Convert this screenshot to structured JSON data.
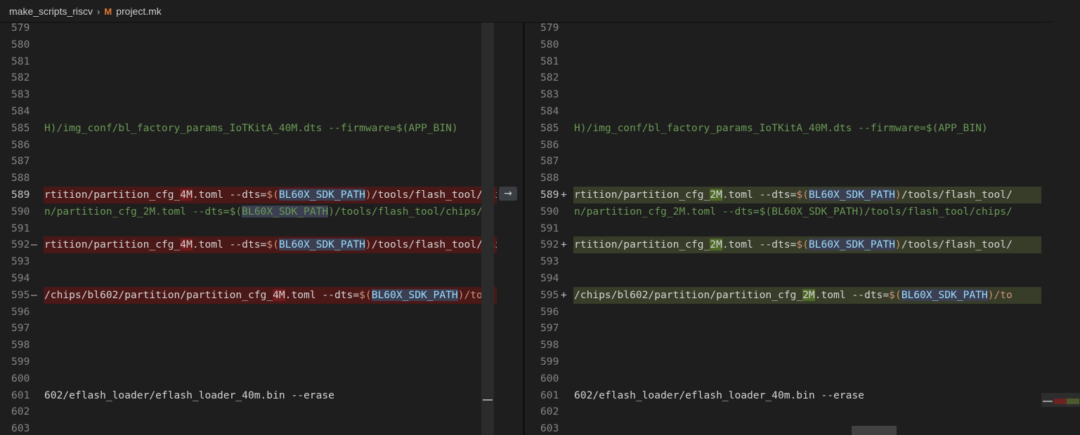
{
  "breadcrumb": {
    "folder": "make_scripts_riscv",
    "separator": "›",
    "file_icon": "M",
    "file": "project.mk"
  },
  "colors": {
    "deleted_line": "#4b1818",
    "inserted_line": "#373d29",
    "deleted_highlight": "#6f1b1b",
    "inserted_highlight": "#4f6a28"
  },
  "revert_button": "→",
  "left": {
    "lines": [
      {
        "num": "579",
        "sign": "",
        "type": "",
        "segments": []
      },
      {
        "num": "580",
        "sign": "",
        "type": "",
        "segments": []
      },
      {
        "num": "581",
        "sign": "",
        "type": "",
        "segments": []
      },
      {
        "num": "582",
        "sign": "",
        "type": "",
        "segments": []
      },
      {
        "num": "583",
        "sign": "",
        "type": "",
        "segments": []
      },
      {
        "num": "584",
        "sign": "",
        "type": "",
        "segments": []
      },
      {
        "num": "585",
        "sign": "",
        "type": "",
        "segments": [
          {
            "text": "H)/img_conf/bl_factory_params_IoTKitA_40M.dts --firmware=$(APP_BIN)",
            "cls": "t-green"
          }
        ]
      },
      {
        "num": "586",
        "sign": "",
        "type": "",
        "segments": []
      },
      {
        "num": "587",
        "sign": "",
        "type": "",
        "segments": []
      },
      {
        "num": "588",
        "sign": "",
        "type": "",
        "segments": []
      },
      {
        "num": "589",
        "sign": "",
        "type": "del",
        "active": true,
        "segments": [
          {
            "text": "rtition/partition_cfg_",
            "cls": "t-white"
          },
          {
            "text": "4M",
            "cls": "t-white hl-del"
          },
          {
            "text": ".toml --dts=",
            "cls": "t-white"
          },
          {
            "text": "$(",
            "cls": "t-orange"
          },
          {
            "text": "BL60X_SDK_PATH",
            "cls": "t-blue hl-var"
          },
          {
            "text": ")",
            "cls": "t-orange"
          },
          {
            "text": "/tools/flash_tool/chips/",
            "cls": "t-white"
          }
        ]
      },
      {
        "num": "590",
        "sign": "",
        "type": "",
        "segments": [
          {
            "text": "n/partition_cfg_2M.toml --dts=$(",
            "cls": "t-dim"
          },
          {
            "text": "BL60X_SDK_PATH",
            "cls": "t-dim hl-var"
          },
          {
            "text": ")/tools/flash_tool/chips/",
            "cls": "t-dim"
          }
        ]
      },
      {
        "num": "591",
        "sign": "",
        "type": "",
        "segments": []
      },
      {
        "num": "592",
        "sign": "—",
        "type": "del",
        "segments": [
          {
            "text": "rtition/partition_cfg_",
            "cls": "t-white"
          },
          {
            "text": "4M",
            "cls": "t-white hl-del"
          },
          {
            "text": ".toml --dts=",
            "cls": "t-white"
          },
          {
            "text": "$(",
            "cls": "t-orange"
          },
          {
            "text": "BL60X_SDK_PATH",
            "cls": "t-blue hl-var"
          },
          {
            "text": ")",
            "cls": "t-orange"
          },
          {
            "text": "/tools/flash_tool/chips/",
            "cls": "t-white"
          }
        ]
      },
      {
        "num": "593",
        "sign": "",
        "type": "",
        "segments": []
      },
      {
        "num": "594",
        "sign": "",
        "type": "",
        "segments": []
      },
      {
        "num": "595",
        "sign": "—",
        "type": "del",
        "segments": [
          {
            "text": "/chips/bl602/partition/partition_cfg_",
            "cls": "t-white"
          },
          {
            "text": "4M",
            "cls": "t-white hl-del"
          },
          {
            "text": ".toml --dts=",
            "cls": "t-white"
          },
          {
            "text": "$(",
            "cls": "t-orange"
          },
          {
            "text": "BL60X_SDK_PATH",
            "cls": "t-blue hl-var"
          },
          {
            "text": ")/to",
            "cls": "t-orange"
          }
        ]
      },
      {
        "num": "596",
        "sign": "",
        "type": "",
        "segments": []
      },
      {
        "num": "597",
        "sign": "",
        "type": "",
        "segments": []
      },
      {
        "num": "598",
        "sign": "",
        "type": "",
        "segments": []
      },
      {
        "num": "599",
        "sign": "",
        "type": "",
        "segments": []
      },
      {
        "num": "600",
        "sign": "",
        "type": "",
        "segments": []
      },
      {
        "num": "601",
        "sign": "",
        "type": "",
        "segments": [
          {
            "text": "602/eflash_loader/eflash_loader_40m.bin --erase",
            "cls": "t-white"
          }
        ]
      },
      {
        "num": "602",
        "sign": "",
        "type": "",
        "segments": []
      },
      {
        "num": "603",
        "sign": "",
        "type": "",
        "segments": []
      }
    ]
  },
  "right": {
    "lines": [
      {
        "num": "579",
        "sign": "",
        "type": "",
        "segments": []
      },
      {
        "num": "580",
        "sign": "",
        "type": "",
        "segments": []
      },
      {
        "num": "581",
        "sign": "",
        "type": "",
        "segments": []
      },
      {
        "num": "582",
        "sign": "",
        "type": "",
        "segments": []
      },
      {
        "num": "583",
        "sign": "",
        "type": "",
        "segments": []
      },
      {
        "num": "584",
        "sign": "",
        "type": "",
        "segments": []
      },
      {
        "num": "585",
        "sign": "",
        "type": "",
        "segments": [
          {
            "text": "H)/img_conf/bl_factory_params_IoTKitA_40M.dts --firmware=$(APP_BIN)",
            "cls": "t-green"
          }
        ]
      },
      {
        "num": "586",
        "sign": "",
        "type": "",
        "segments": []
      },
      {
        "num": "587",
        "sign": "",
        "type": "",
        "segments": []
      },
      {
        "num": "588",
        "sign": "",
        "type": "",
        "segments": []
      },
      {
        "num": "589",
        "sign": "+",
        "type": "ins",
        "active": true,
        "segments": [
          {
            "text": "rtition/partition_cfg_",
            "cls": "t-white"
          },
          {
            "text": "2M",
            "cls": "t-white hl-ins"
          },
          {
            "text": ".toml --dts=",
            "cls": "t-white"
          },
          {
            "text": "$(",
            "cls": "t-orange"
          },
          {
            "text": "BL60X_SDK_PATH",
            "cls": "t-blue hl-var"
          },
          {
            "text": ")",
            "cls": "t-orange"
          },
          {
            "text": "/tools/flash_tool/",
            "cls": "t-white"
          }
        ]
      },
      {
        "num": "590",
        "sign": "",
        "type": "",
        "segments": [
          {
            "text": "n/partition_cfg_2M.toml --dts=$(BL60X_SDK_PATH)/tools/flash_tool/chips/",
            "cls": "t-dim"
          }
        ]
      },
      {
        "num": "591",
        "sign": "",
        "type": "",
        "segments": []
      },
      {
        "num": "592",
        "sign": "+",
        "type": "ins",
        "segments": [
          {
            "text": "rtition/partition_cfg_",
            "cls": "t-white"
          },
          {
            "text": "2M",
            "cls": "t-white hl-ins"
          },
          {
            "text": ".toml --dts=",
            "cls": "t-white"
          },
          {
            "text": "$(",
            "cls": "t-orange"
          },
          {
            "text": "BL60X_SDK_PATH",
            "cls": "t-blue hl-var"
          },
          {
            "text": ")",
            "cls": "t-orange"
          },
          {
            "text": "/tools/flash_tool/",
            "cls": "t-white"
          }
        ]
      },
      {
        "num": "593",
        "sign": "",
        "type": "",
        "segments": []
      },
      {
        "num": "594",
        "sign": "",
        "type": "",
        "segments": []
      },
      {
        "num": "595",
        "sign": "+",
        "type": "ins",
        "segments": [
          {
            "text": "/chips/bl602/partition/partition_cfg_",
            "cls": "t-white"
          },
          {
            "text": "2M",
            "cls": "t-white hl-ins"
          },
          {
            "text": ".toml --dts=",
            "cls": "t-white"
          },
          {
            "text": "$(",
            "cls": "t-orange"
          },
          {
            "text": "BL60X_SDK_PATH",
            "cls": "t-blue hl-var"
          },
          {
            "text": ")/to",
            "cls": "t-orange"
          }
        ]
      },
      {
        "num": "596",
        "sign": "",
        "type": "",
        "segments": []
      },
      {
        "num": "597",
        "sign": "",
        "type": "",
        "segments": []
      },
      {
        "num": "598",
        "sign": "",
        "type": "",
        "segments": []
      },
      {
        "num": "599",
        "sign": "",
        "type": "",
        "segments": []
      },
      {
        "num": "600",
        "sign": "",
        "type": "",
        "segments": []
      },
      {
        "num": "601",
        "sign": "",
        "type": "",
        "segments": [
          {
            "text": "602/eflash_loader/eflash_loader_40m.bin --erase",
            "cls": "t-white"
          }
        ]
      },
      {
        "num": "602",
        "sign": "",
        "type": "",
        "segments": []
      },
      {
        "num": "603",
        "sign": "",
        "type": "",
        "segments": []
      }
    ]
  }
}
